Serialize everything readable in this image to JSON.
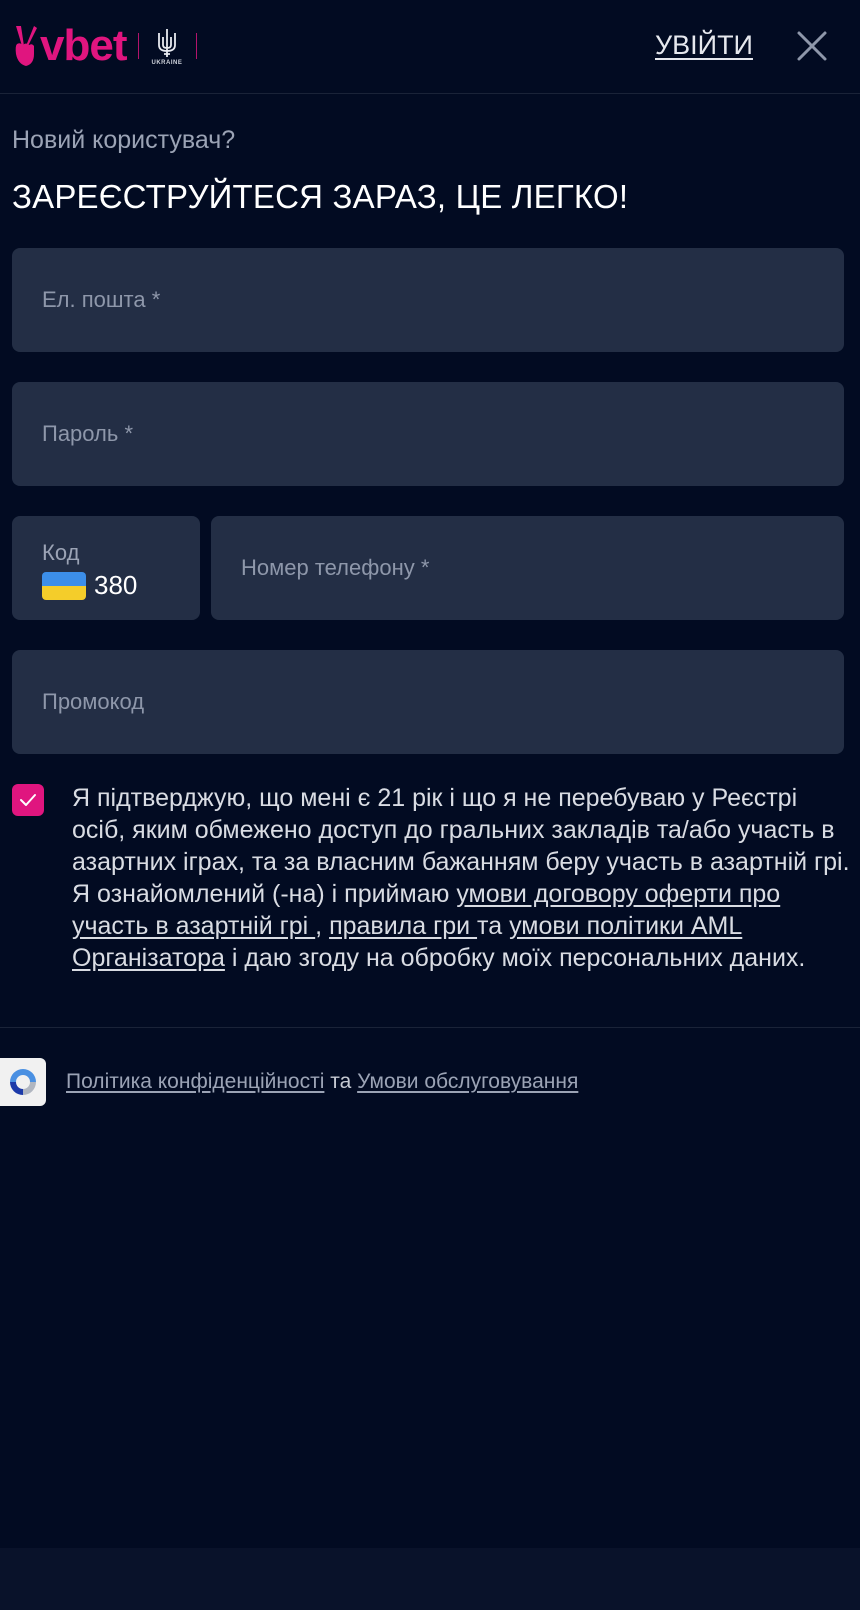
{
  "header": {
    "logo_text": "vbet",
    "logo_sub": "UKRAINE",
    "login_label": "УВІЙТИ"
  },
  "intro": {
    "subtitle": "Новий користувач?",
    "heading": "ЗАРЕЄСТРУЙТЕСЯ ЗАРАЗ, ЦЕ ЛЕГКО!"
  },
  "form": {
    "email_placeholder": "Ел. пошта *",
    "password_placeholder": "Пароль *",
    "code_label": "Код",
    "code_value": "380",
    "phone_placeholder": "Номер телефону *",
    "promo_placeholder": "Промокод"
  },
  "consent": {
    "checked": true,
    "text_before": "Я підтверджую, що мені є 21 рік і що я не перебуваю у Реєстрі осіб, яким обмежено доступ до гральних закладів та/або участь в азартних іграх, та за власним бажанням беру участь в азартній грі. Я ознайомлений (-на) і приймаю ",
    "link_offer": "умови договору оферти про участь в азартній грі ",
    "sep1": ", ",
    "link_rules": "правила гри ",
    "sep2": "та ",
    "link_aml": "умови політики AML Організатора",
    "text_after": " і даю згоду на обробку моїх персональних даних."
  },
  "recaptcha": {
    "privacy_link": "Політика конфіденційності",
    "and": " та ",
    "terms_link": "Умови обслуговування"
  },
  "colors": {
    "background": "#020b22",
    "field": "#232e45",
    "accent": "#e0157f"
  }
}
